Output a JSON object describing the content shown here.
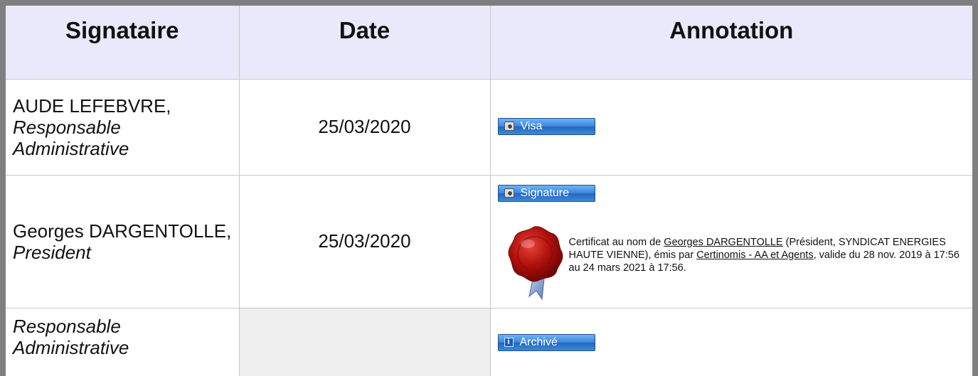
{
  "headers": {
    "signataire": "Signataire",
    "date": "Date",
    "annotation": "Annotation"
  },
  "rows": [
    {
      "name": "AUDE LEFEBVRE,",
      "role": "Responsable Administrative",
      "date": "25/03/2020",
      "button": "Visa"
    },
    {
      "name": "Georges DARGENTOLLE,",
      "role": "President",
      "date": "25/03/2020",
      "button": "Signature",
      "certificate": {
        "prefix": "Certificat au nom de ",
        "holder_link": "Georges DARGENTOLLE",
        "mid": " (Président, SYNDICAT ENERGIES HAUTE VIENNE), émis par ",
        "issuer_link": "Certinomis - AA et Agents",
        "suffix": ", valide du 28 nov. 2019 à 17:56 au 24 mars 2021 à 17:56."
      }
    },
    {
      "role": "Responsable Administrative",
      "date": "",
      "button": "Archivé"
    }
  ],
  "icons": {
    "visa": "camera-icon",
    "signature": "camera-icon",
    "archive": "info-icon",
    "seal": "wax-seal-icon"
  },
  "colors": {
    "header_bg": "#e9e9fb",
    "button_blue": "#3a86dc",
    "seal_red": "#b0100c",
    "frame_gray": "#7f7f7f"
  }
}
